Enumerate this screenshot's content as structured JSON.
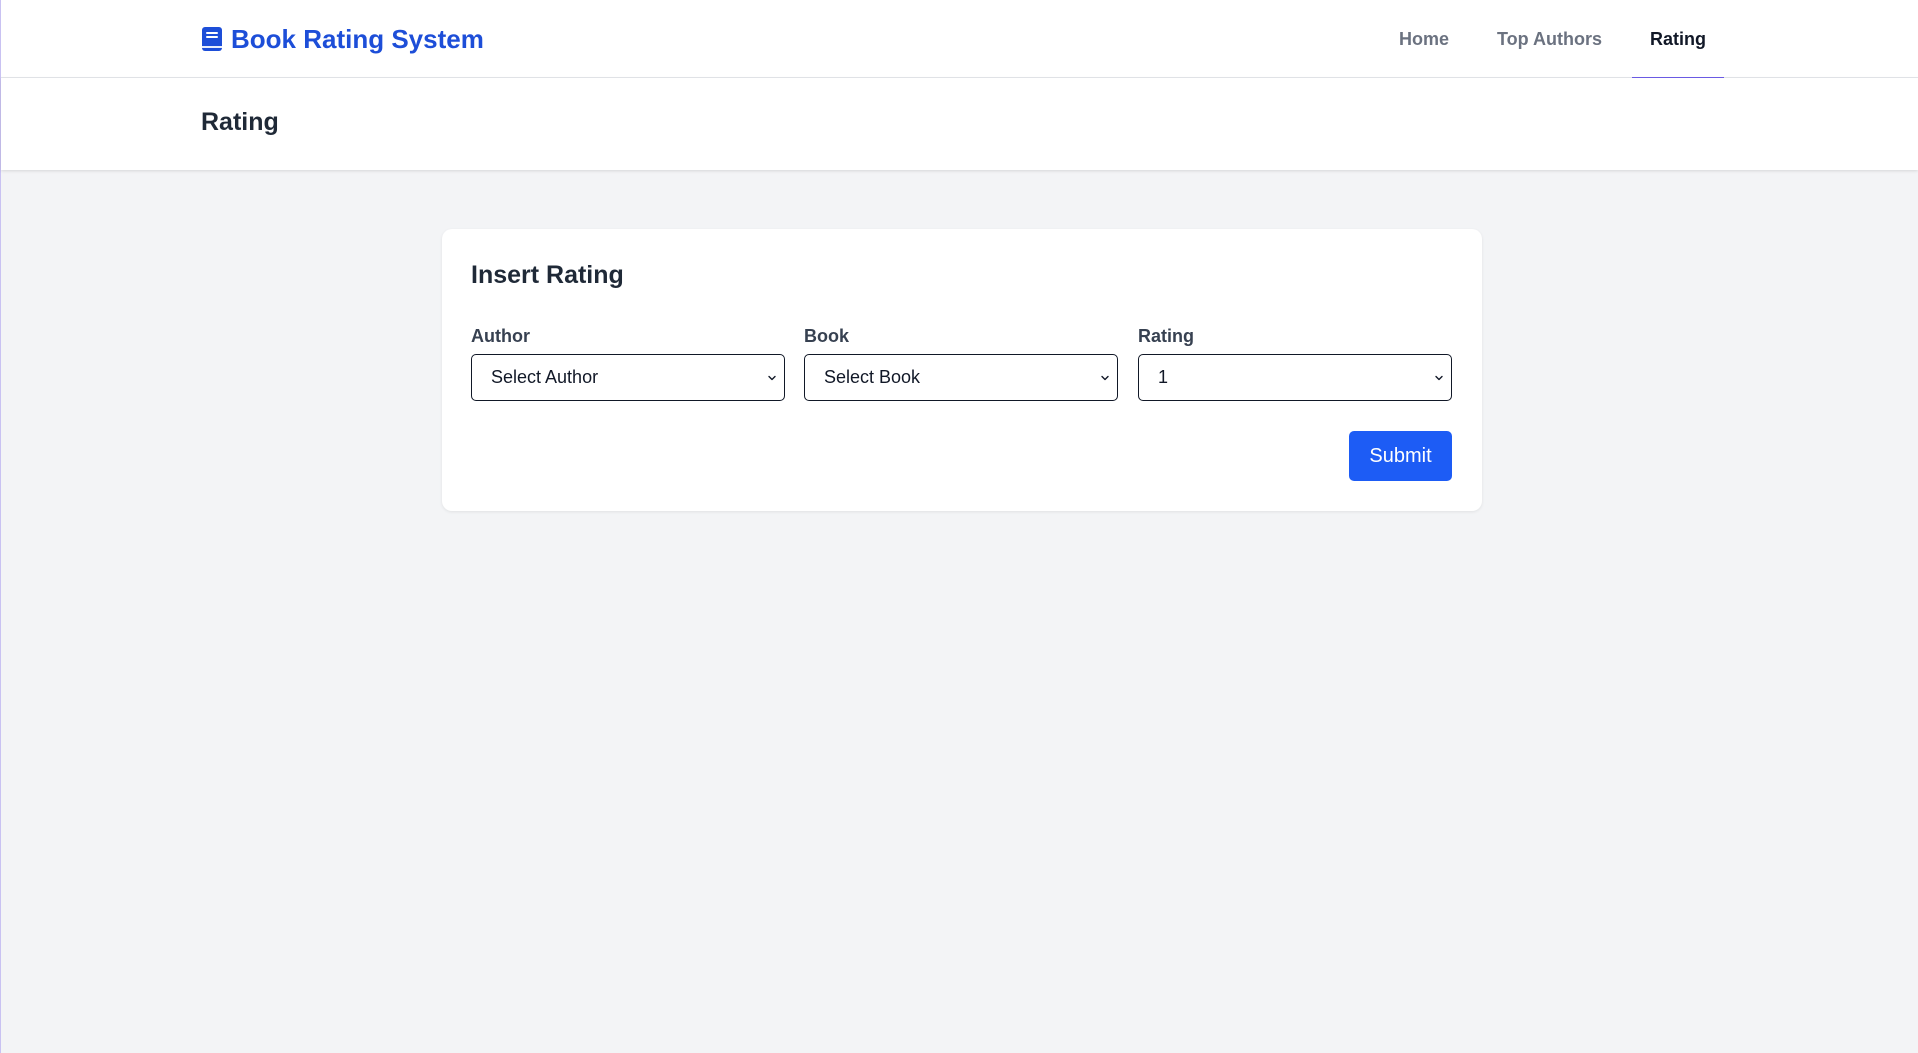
{
  "header": {
    "brand": "Book Rating System",
    "brand_icon": "book-icon",
    "nav": [
      {
        "label": "Home",
        "active": false
      },
      {
        "label": "Top Authors",
        "active": false
      },
      {
        "label": "Rating",
        "active": true
      }
    ]
  },
  "page": {
    "title": "Rating"
  },
  "form": {
    "title": "Insert Rating",
    "fields": [
      {
        "label": "Author",
        "value": "Select Author"
      },
      {
        "label": "Book",
        "value": "Select Book"
      },
      {
        "label": "Rating",
        "value": "1"
      }
    ],
    "submit_label": "Submit"
  },
  "colors": {
    "brand": "#1d4ed8",
    "primary_button": "#1d5cf5",
    "active_underline": "#6d5ce8",
    "background": "#f3f4f6"
  }
}
